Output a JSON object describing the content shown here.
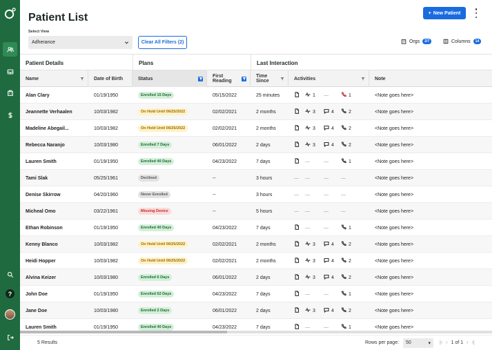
{
  "header": {
    "title": "Patient List",
    "new_button": "New Patient",
    "new_button_icon": "plus-icon"
  },
  "filters": {
    "view_label": "Select View",
    "view_value": "Adherance",
    "clear_label": "Clear All Filters (2)",
    "orgs_label": "Orgs",
    "orgs_count": "2/7",
    "columns_label": "Columns",
    "columns_count": "14"
  },
  "groups": {
    "patient_details": "Patient Details",
    "plans": "Plans",
    "last_interaction": "Last Interaction"
  },
  "columns": {
    "name": "Name",
    "dob": "Date of Birth",
    "status": "Status",
    "first_reading": "First Reading",
    "time_since": "Time Since",
    "activities": "Activities",
    "note": "Note"
  },
  "rows": [
    {
      "name": "Alan Clary",
      "dob": "01/19/1950",
      "status": "Enrolled 15 Days",
      "status_type": "enrolled",
      "first": "05/15/2022",
      "time": "25 minutes",
      "doc": true,
      "vitals": "1",
      "msg": "—",
      "call": "1",
      "call_alert": true,
      "note": "<Note goes here>"
    },
    {
      "name": "Jeannette Verhaalen",
      "dob": "10/03/1982",
      "status": "On Hold Until 06/25/2022",
      "status_type": "hold",
      "first": "02/02/2021",
      "time": "2 months",
      "doc": true,
      "vitals": "3",
      "msg": "4",
      "call": "2",
      "call_alert": false,
      "note": "<Note goes here>"
    },
    {
      "name": "Madeline Abegail...",
      "dob": "10/03/1982",
      "status": "On Hold Until 06/25/2022",
      "status_type": "hold",
      "first": "02/02/2021",
      "time": "2 months",
      "doc": true,
      "vitals": "3",
      "msg": "4",
      "call": "2",
      "call_alert": false,
      "note": "<Note goes here>"
    },
    {
      "name": "Rebecca Naranjo",
      "dob": "10/03/1980",
      "status": "Enrolled 7 Days",
      "status_type": "enrolled",
      "first": "06/01/2022",
      "time": "2 days",
      "doc": true,
      "vitals": "3",
      "msg": "4",
      "call": "2",
      "call_alert": false,
      "note": "<Note goes here>"
    },
    {
      "name": "Lauren Smith",
      "dob": "01/19/1950",
      "status": "Enrolled 40 Days",
      "status_type": "enrolled",
      "first": "04/23/2022",
      "time": "7 days",
      "doc": true,
      "vitals": "—",
      "msg": "—",
      "call": "1",
      "call_alert": false,
      "note": "<Note goes here>"
    },
    {
      "name": "Tami Slak",
      "dob": "05/25/1961",
      "status": "Declined",
      "status_type": "declined",
      "first": "--",
      "time": "3 hours",
      "doc": false,
      "vitals": "—",
      "msg": "—",
      "call": "—",
      "call_alert": false,
      "note": "<Note goes here>"
    },
    {
      "name": "Denise Skirrow",
      "dob": "04/20/1960",
      "status": "Never Enrolled",
      "status_type": "never",
      "first": "--",
      "time": "3 hours",
      "doc": false,
      "vitals": "—",
      "msg": "—",
      "call": "—",
      "call_alert": false,
      "note": "<Note goes here>"
    },
    {
      "name": "Micheal Omo",
      "dob": "03/22/1961",
      "status": "Missing Device",
      "status_type": "missing",
      "first": "--",
      "time": "5 hours",
      "doc": false,
      "vitals": "—",
      "msg": "—",
      "call": "—",
      "call_alert": false,
      "note": "<Note goes here>"
    },
    {
      "name": "Ethan Robinson",
      "dob": "01/19/1950",
      "status": "Enrolled 40 Days",
      "status_type": "enrolled",
      "first": "04/23/2022",
      "time": "7 days",
      "doc": true,
      "vitals": "—",
      "msg": "—",
      "call": "1",
      "call_alert": false,
      "note": "<Note goes here>"
    },
    {
      "name": "Kenny Blanco",
      "dob": "10/03/1982",
      "status": "On Hold Until 06/25/2022",
      "status_type": "hold",
      "first": "02/02/2021",
      "time": "2 months",
      "doc": true,
      "vitals": "3",
      "msg": "4",
      "call": "2",
      "call_alert": false,
      "note": "<Note goes here>"
    },
    {
      "name": "Heidi Hopper",
      "dob": "10/03/1982",
      "status": "On Hold Until 06/25/2022",
      "status_type": "hold",
      "first": "02/02/2021",
      "time": "2 months",
      "doc": true,
      "vitals": "3",
      "msg": "4",
      "call": "2",
      "call_alert": false,
      "note": "<Note goes here>"
    },
    {
      "name": "Alvina Keizer",
      "dob": "10/03/1980",
      "status": "Enrolled 6 Days",
      "status_type": "enrolled",
      "first": "06/01/2022",
      "time": "2 days",
      "doc": true,
      "vitals": "3",
      "msg": "4",
      "call": "2",
      "call_alert": false,
      "note": "<Note goes here>"
    },
    {
      "name": "John Doe",
      "dob": "01/19/1950",
      "status": "Enrolled 62 Days",
      "status_type": "enrolled",
      "first": "04/23/2022",
      "time": "7 days",
      "doc": true,
      "vitals": "—",
      "msg": "—",
      "call": "1",
      "call_alert": false,
      "note": "<Note goes here>"
    },
    {
      "name": "Jane Doe",
      "dob": "10/03/1980",
      "status": "Enrolled 2 Days",
      "status_type": "enrolled",
      "first": "06/01/2022",
      "time": "2 days",
      "doc": true,
      "vitals": "3",
      "msg": "4",
      "call": "2",
      "call_alert": false,
      "note": "<Note goes here>"
    },
    {
      "name": "Lauren Smith",
      "dob": "01/19/1950",
      "status": "Enrolled 40 Days",
      "status_type": "enrolled",
      "first": "04/23/2022",
      "time": "7 days",
      "doc": true,
      "vitals": "—",
      "msg": "—",
      "call": "1",
      "call_alert": false,
      "note": "<Note goes here>"
    }
  ],
  "footer": {
    "results": "5 Results",
    "rows_per_page_label": "Rows per page:",
    "rows_per_page_value": "50",
    "page_info": "1 of 1"
  },
  "colors": {
    "sidebar": "#1f6b3f",
    "accent": "#1a6be0",
    "enrolled": "#1a6b34",
    "hold": "#9a6a00",
    "missing": "#c32a2a"
  }
}
